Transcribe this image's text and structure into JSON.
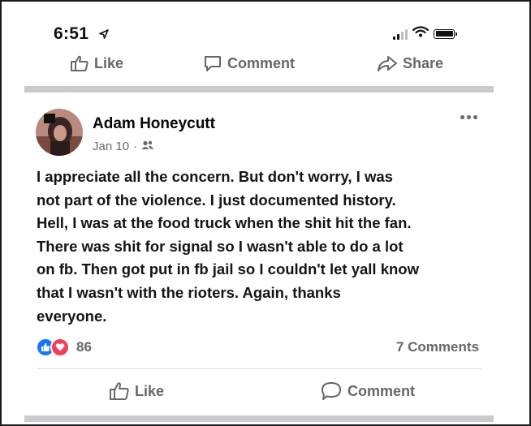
{
  "status_bar": {
    "time": "6:51",
    "location_icon": "location-arrow-icon",
    "signal_icon": "cell-signal-icon",
    "wifi_icon": "wifi-icon",
    "battery_icon": "battery-icon"
  },
  "previous_post_actions": {
    "like_label": "Like",
    "comment_label": "Comment",
    "share_label": "Share"
  },
  "post": {
    "author": "Adam Honeycutt",
    "date": "Jan 10",
    "audience_icon": "friends-icon",
    "body": "I appreciate all the concern. But don't worry, I was\nnot part of the violence. I just documented history.\nHell, I was at the food truck when the shit hit the fan.\nThere was shit for signal so I wasn't able to do a lot\non fb. Then got put in fb jail so I couldn't let yall know\nthat I wasn't with the rioters. Again, thanks\neveryone.",
    "reaction_count": "86",
    "reaction_types": [
      "like",
      "love"
    ],
    "comments_label": "7 Comments",
    "actions": {
      "like_label": "Like",
      "comment_label": "Comment"
    }
  },
  "colors": {
    "secondary_text": "#65676b",
    "like_blue": "#1877f2",
    "love_red": "#f33e58",
    "divider_gray": "#c9cbcf"
  }
}
